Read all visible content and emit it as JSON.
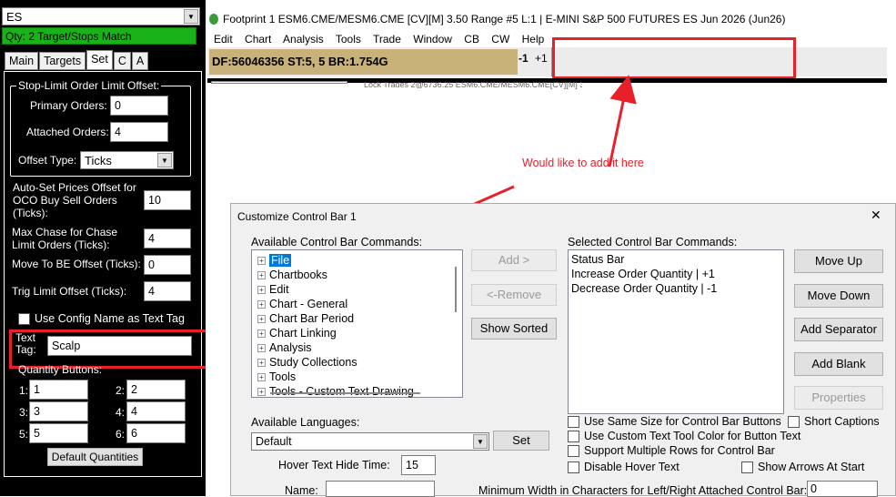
{
  "left_panel": {
    "symbol": "ES",
    "status": "Qty: 2 Target/Stops Match",
    "tabs": [
      "Main",
      "Targets",
      "Set",
      "C",
      "A"
    ],
    "active_tab": "Set",
    "stop_limit_group": {
      "legend": "Stop-Limit Order Limit Offset:",
      "primary_label": "Primary Orders:",
      "primary_value": "0",
      "attached_label": "Attached Orders:",
      "attached_value": "4",
      "offset_type_label": "Offset Type:",
      "offset_type_value": "Ticks"
    },
    "auto_set_label": "Auto-Set Prices Offset for OCO Buy Sell Orders (Ticks):",
    "auto_set_value": "10",
    "max_chase_label": "Max Chase for Chase Limit Orders (Ticks):",
    "max_chase_value": "4",
    "move_be_label": "Move To BE Offset (Ticks):",
    "move_be_value": "0",
    "trig_limit_label": "Trig Limit Offset (Ticks):",
    "trig_limit_value": "4",
    "use_config_label": "Use Config Name as Text Tag",
    "text_tag_label": "Text Tag:",
    "text_tag_value": "Scalp",
    "quantity_buttons_label": "Quantity Buttons:",
    "quantities": [
      {
        "label": "1:",
        "value": "1"
      },
      {
        "label": "2:",
        "value": "2"
      },
      {
        "label": "3:",
        "value": "3"
      },
      {
        "label": "4:",
        "value": "4"
      },
      {
        "label": "5:",
        "value": "5"
      },
      {
        "label": "6:",
        "value": "6"
      }
    ],
    "default_quantities_button": "Default Quantities"
  },
  "chart_window": {
    "title": "Footprint 1 ESM6.CME/MESM6.CME [CV][M]  3.50 Range #5 L:1 | E-MINI S&P 500 FUTURES ES Jun 2026 (Jun26)",
    "menu": [
      "Edit",
      "Chart",
      "Analysis",
      "Tools",
      "Trade",
      "Window",
      "CB",
      "CW",
      "Help"
    ],
    "control_bar_status": "DF:56046356  ST:5, 5  BR:1.754G",
    "qty_minus": "-1",
    "qty_plus": "+1",
    "partial_line": "Lock Trades  2@6736.25  ESM6.CME/MESM6.CME[CV][M]  3.50"
  },
  "annotation": {
    "text": "Would like to add it here",
    "color": "#e8202a"
  },
  "dialog": {
    "title": "Customize Control Bar 1",
    "close": "✕",
    "available_label": "Available Control Bar Commands:",
    "available_items": [
      "File",
      "Chartbooks",
      "Edit",
      "Chart - General",
      "Chart Bar Period",
      "Chart Linking",
      "Analysis",
      "Study Collections",
      "Tools",
      "Tools - Custom Text Drawing"
    ],
    "selected_item": "File",
    "buttons_middle": [
      "Add >",
      "<-Remove",
      "Show Sorted"
    ],
    "selected_label": "Selected Control Bar Commands:",
    "selected_items": [
      "Status Bar",
      "Increase Order Quantity | +1",
      "Decrease Order Quantity | -1"
    ],
    "buttons_right": [
      "Move Up",
      "Move Down",
      "Add Separator",
      "Add Blank",
      "Properties"
    ],
    "languages_label": "Available Languages:",
    "language_value": "Default",
    "set_button": "Set",
    "hover_label": "Hover Text Hide Time:",
    "hover_value": "15",
    "name_label": "Name:",
    "options": [
      "Use Same Size for Control Bar Buttons",
      "Use Custom Text Tool Color for Button Text",
      "Support Multiple Rows for Control Bar",
      "Disable Hover Text"
    ],
    "short_captions": "Short Captions",
    "show_arrows": "Show Arrows At Start",
    "min_width_label": "Minimum Width in Characters for Left/Right Attached Control Bar:",
    "min_width_value": "0"
  }
}
